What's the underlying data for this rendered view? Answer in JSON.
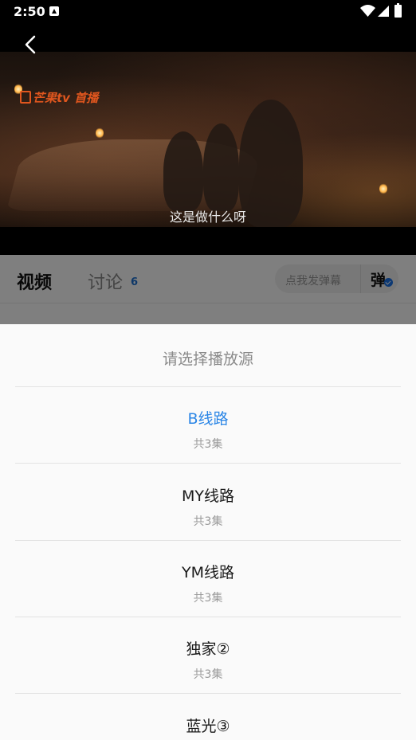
{
  "status_bar": {
    "time": "2:50",
    "notification_icon": "a-icon",
    "wifi_icon": "wifi-icon",
    "signal_icon": "signal-icon",
    "battery_icon": "battery-charging-icon"
  },
  "player": {
    "back_icon": "chevron-left-icon",
    "logo_text": "芒果tv",
    "logo_badge": "首播",
    "subtitle": "这是做什么呀"
  },
  "tabs": {
    "video_label": "视频",
    "discuss_label": "讨论",
    "discuss_count": "6",
    "danmu_placeholder": "点我发弹幕",
    "danmu_button": "弹"
  },
  "sheet": {
    "title": "请选择播放源",
    "accent_color": "#2b86e6",
    "sources": [
      {
        "name": "B线路",
        "episodes": "共3集",
        "selected": true
      },
      {
        "name": "MY线路",
        "episodes": "共3集",
        "selected": false
      },
      {
        "name": "YM线路",
        "episodes": "共3集",
        "selected": false
      },
      {
        "name": "独家②",
        "episodes": "共3集",
        "selected": false
      },
      {
        "name": "蓝光③",
        "episodes": "",
        "selected": false
      }
    ]
  }
}
